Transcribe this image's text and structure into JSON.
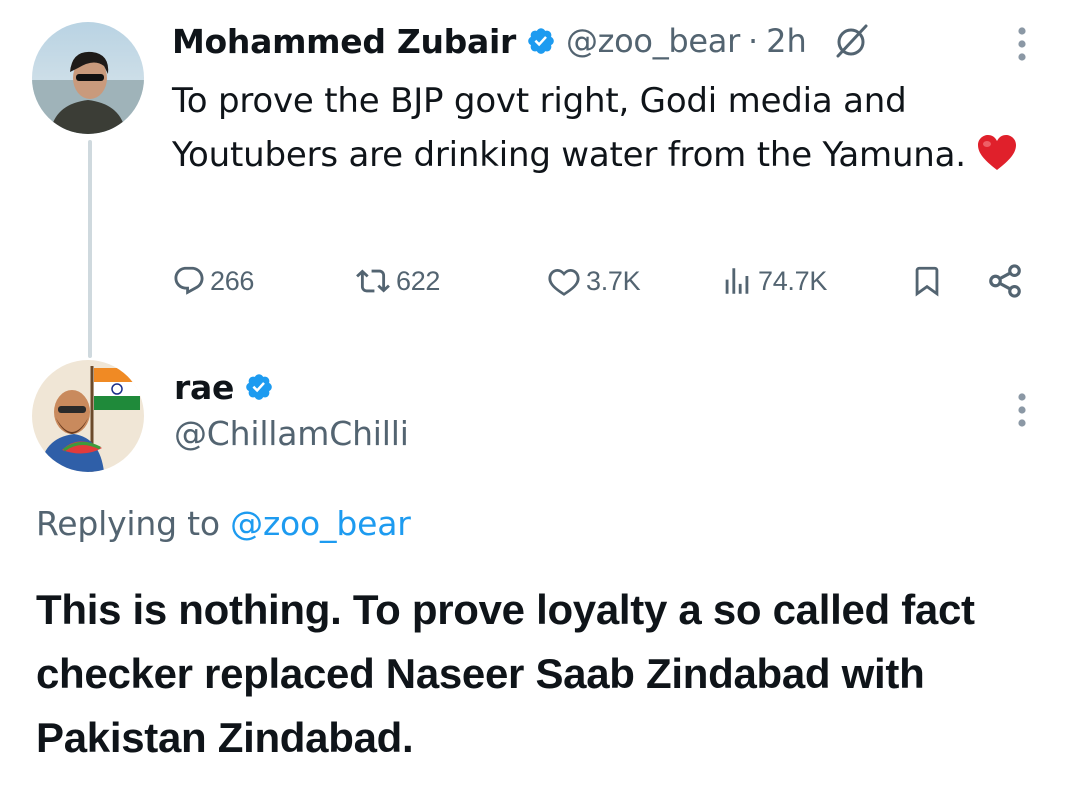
{
  "tweet": {
    "author_name": "Mohammed Zubair",
    "handle": "@zoo_bear",
    "separator": "·",
    "time": "2h",
    "text": "To prove the BJP govt right, Godi media and Youtubers are drinking water from the Yamuna.",
    "stats": {
      "replies": "266",
      "reposts": "622",
      "likes": "3.7K",
      "views": "74.7K"
    }
  },
  "reply": {
    "author_name": "rae",
    "handle": "@ChillamChilli",
    "replying_prefix": "Replying to ",
    "replying_to": "@zoo_bear",
    "text": "This is nothing. To prove loyalty a so called fact checker replaced Naseer Saab Zindabad with Pakistan Zindabad."
  },
  "colors": {
    "text": "#0f1419",
    "secondary": "#536471",
    "accent": "#1d9bf0",
    "thread_line": "#cfd9de"
  },
  "icons": [
    "verified-badge-icon",
    "grok-icon",
    "more-options-icon",
    "reply-icon",
    "repost-icon",
    "like-icon",
    "views-icon",
    "bookmark-icon",
    "share-icon",
    "red-heart-emoji"
  ]
}
